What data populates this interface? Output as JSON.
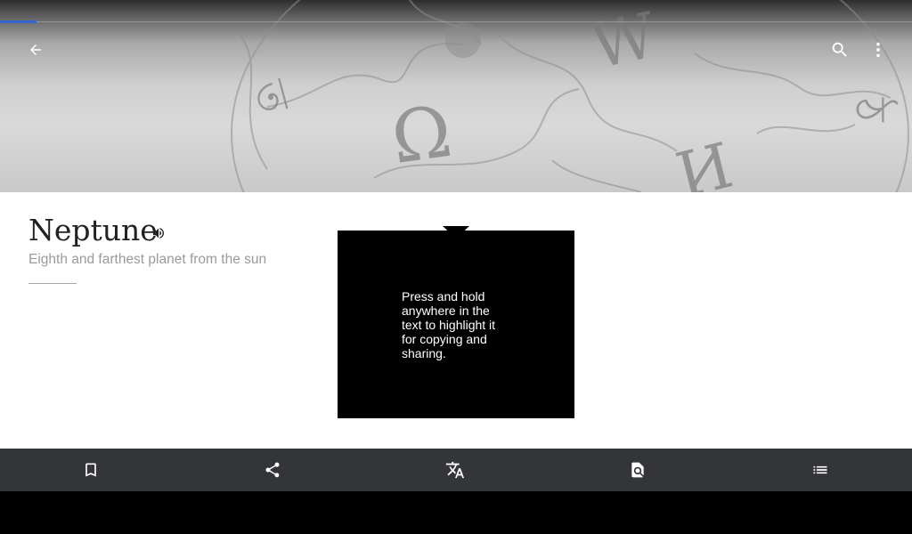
{
  "app": {
    "progress_fraction": 0.04,
    "accent_color": "#3366cc"
  },
  "header": {
    "back_icon": "arrow-left-icon",
    "search_icon": "search-icon",
    "overflow_icon": "more-vert-icon"
  },
  "article": {
    "title": "Neptune",
    "description": "Eighth and farthest planet from the sun",
    "audio_icon": "volume-icon"
  },
  "tooltip": {
    "text": "Press and hold anywhere in the text to highlight it for copying and sharing."
  },
  "toolbar": {
    "items": [
      {
        "icon": "bookmark-icon"
      },
      {
        "icon": "share-icon"
      },
      {
        "icon": "translate-icon"
      },
      {
        "icon": "find-in-page-icon"
      },
      {
        "icon": "table-of-contents-icon"
      }
    ]
  }
}
